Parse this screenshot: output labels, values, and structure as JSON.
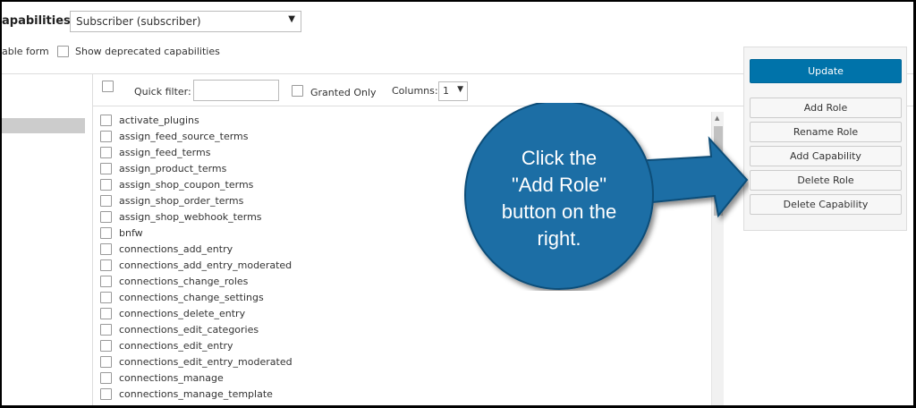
{
  "header": {
    "capabilities_label": "apabilities:",
    "role_select_value": "Subscriber (subscriber)",
    "option_left": "able form",
    "option_deprecated": "Show deprecated capabilities"
  },
  "filter": {
    "quick_filter_label": "Quick filter:",
    "quick_filter_value": "",
    "granted_only_label": "Granted Only",
    "columns_label": "Columns:",
    "columns_value": "1"
  },
  "capabilities": [
    "activate_plugins",
    "assign_feed_source_terms",
    "assign_feed_terms",
    "assign_product_terms",
    "assign_shop_coupon_terms",
    "assign_shop_order_terms",
    "assign_shop_webhook_terms",
    "bnfw",
    "connections_add_entry",
    "connections_add_entry_moderated",
    "connections_change_roles",
    "connections_change_settings",
    "connections_delete_entry",
    "connections_edit_categories",
    "connections_edit_entry",
    "connections_edit_entry_moderated",
    "connections_manage",
    "connections_manage_template"
  ],
  "side_panel": {
    "update": "Update",
    "add_role": "Add Role",
    "rename_role": "Rename Role",
    "add_capability": "Add Capability",
    "delete_role": "Delete Role",
    "delete_capability": "Delete Capability"
  },
  "callout": {
    "text_line1": "Click the",
    "text_line2": "\"Add Role\"",
    "text_line3": "button on the",
    "text_line4": "right.",
    "color": "#1a6ea5"
  }
}
